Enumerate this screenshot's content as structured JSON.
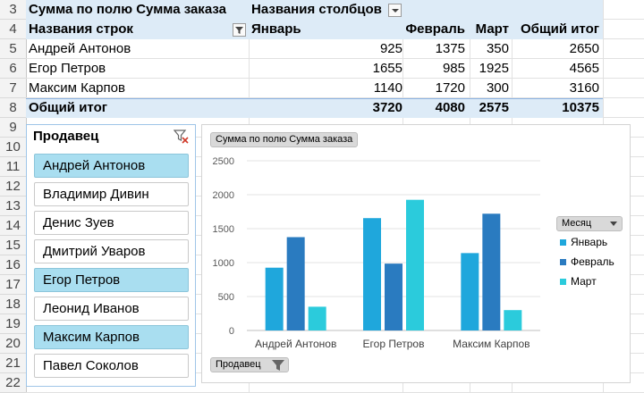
{
  "rows": [
    "3",
    "4",
    "5",
    "6",
    "7",
    "8",
    "9",
    "10",
    "11",
    "12",
    "13",
    "14",
    "15",
    "16",
    "17",
    "18",
    "19",
    "20",
    "21",
    "22"
  ],
  "pivot": {
    "header_value": "Сумма по полю Сумма заказа",
    "col_labels_title": "Названия столбцов",
    "row_labels_title": "Названия строк",
    "columns": [
      "Январь",
      "Февраль",
      "Март",
      "Общий итог"
    ],
    "data_rows": [
      {
        "name": "Андрей Антонов",
        "values": [
          "925",
          "1375",
          "350",
          "2650"
        ]
      },
      {
        "name": "Егор Петров",
        "values": [
          "1655",
          "985",
          "1925",
          "4565"
        ]
      },
      {
        "name": "Максим Карпов",
        "values": [
          "1140",
          "1720",
          "300",
          "3160"
        ]
      }
    ],
    "total_row": {
      "name": "Общий итог",
      "values": [
        "3720",
        "4080",
        "2575",
        "10375"
      ]
    }
  },
  "slicer": {
    "title": "Продавец",
    "items": [
      {
        "label": "Андрей Антонов",
        "selected": true
      },
      {
        "label": "Владимир Дивин",
        "selected": false
      },
      {
        "label": "Денис Зуев",
        "selected": false
      },
      {
        "label": "Дмитрий Уваров",
        "selected": false
      },
      {
        "label": "Егор Петров",
        "selected": true
      },
      {
        "label": "Леонид Иванов",
        "selected": false
      },
      {
        "label": "Максим Карпов",
        "selected": true
      },
      {
        "label": "Павел Соколов",
        "selected": false
      }
    ]
  },
  "chart_buttons": {
    "value_field": "Сумма по полю Сумма заказа",
    "legend_field": "Месяц",
    "axis_field": "Продавец"
  },
  "chart_data": {
    "type": "bar",
    "categories": [
      "Андрей Антонов",
      "Егор Петров",
      "Максим Карпов"
    ],
    "series": [
      {
        "name": "Январь",
        "values": [
          925,
          1655,
          1140
        ],
        "color": "#1fa7dc"
      },
      {
        "name": "Февраль",
        "values": [
          1375,
          985,
          1720
        ],
        "color": "#2a7bc0"
      },
      {
        "name": "Март",
        "values": [
          350,
          1925,
          300
        ],
        "color": "#2bcbdc"
      }
    ],
    "ylim": [
      0,
      2500
    ],
    "yticks": [
      "0",
      "500",
      "1000",
      "1500",
      "2000",
      "2500"
    ],
    "grid": true,
    "legend": "right"
  }
}
